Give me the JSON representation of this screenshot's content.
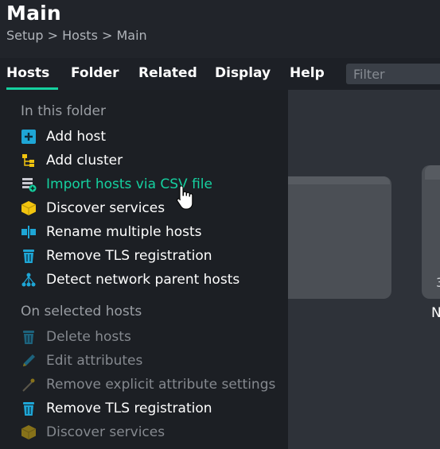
{
  "header": {
    "title": "Main",
    "breadcrumb": "Setup > Hosts > Main"
  },
  "menubar": {
    "items": [
      {
        "label": "Hosts",
        "active": true
      },
      {
        "label": "Folder"
      },
      {
        "label": "Related"
      },
      {
        "label": "Display"
      },
      {
        "label": "Help"
      }
    ],
    "filter_placeholder": "Filter"
  },
  "dropdown": {
    "section_in_folder": "In this folder",
    "in_folder_items": [
      {
        "label": "Add host",
        "icon": "plus-icon"
      },
      {
        "label": "Add cluster",
        "icon": "cluster-icon"
      },
      {
        "label": "Import hosts via CSV file",
        "icon": "csv-import-icon",
        "hovered": true
      },
      {
        "label": "Discover services",
        "icon": "cube-icon"
      },
      {
        "label": "Rename multiple hosts",
        "icon": "rename-icon"
      },
      {
        "label": "Remove TLS registration",
        "icon": "trash-icon"
      },
      {
        "label": "Detect network parent hosts",
        "icon": "network-icon"
      }
    ],
    "section_selected": "On selected hosts",
    "selected_items": [
      {
        "label": "Delete hosts",
        "icon": "trash-icon",
        "disabled": true
      },
      {
        "label": "Edit attributes",
        "icon": "pencil-icon",
        "disabled": true
      },
      {
        "label": "Remove explicit attribute settings",
        "icon": "wand-icon",
        "disabled": true
      },
      {
        "label": "Remove TLS registration",
        "icon": "trash-icon",
        "disabled": false
      },
      {
        "label": "Discover services",
        "icon": "cube-icon",
        "disabled": true
      }
    ]
  },
  "background": {
    "tile_number": "3",
    "tile_letter": "N"
  },
  "colors": {
    "accent": "#15d1a0",
    "menu_bg": "#1d2026",
    "dropdown_bg": "#1c1f24",
    "icon_blue": "#1ea6d6",
    "icon_yellow": "#f1c40f"
  }
}
